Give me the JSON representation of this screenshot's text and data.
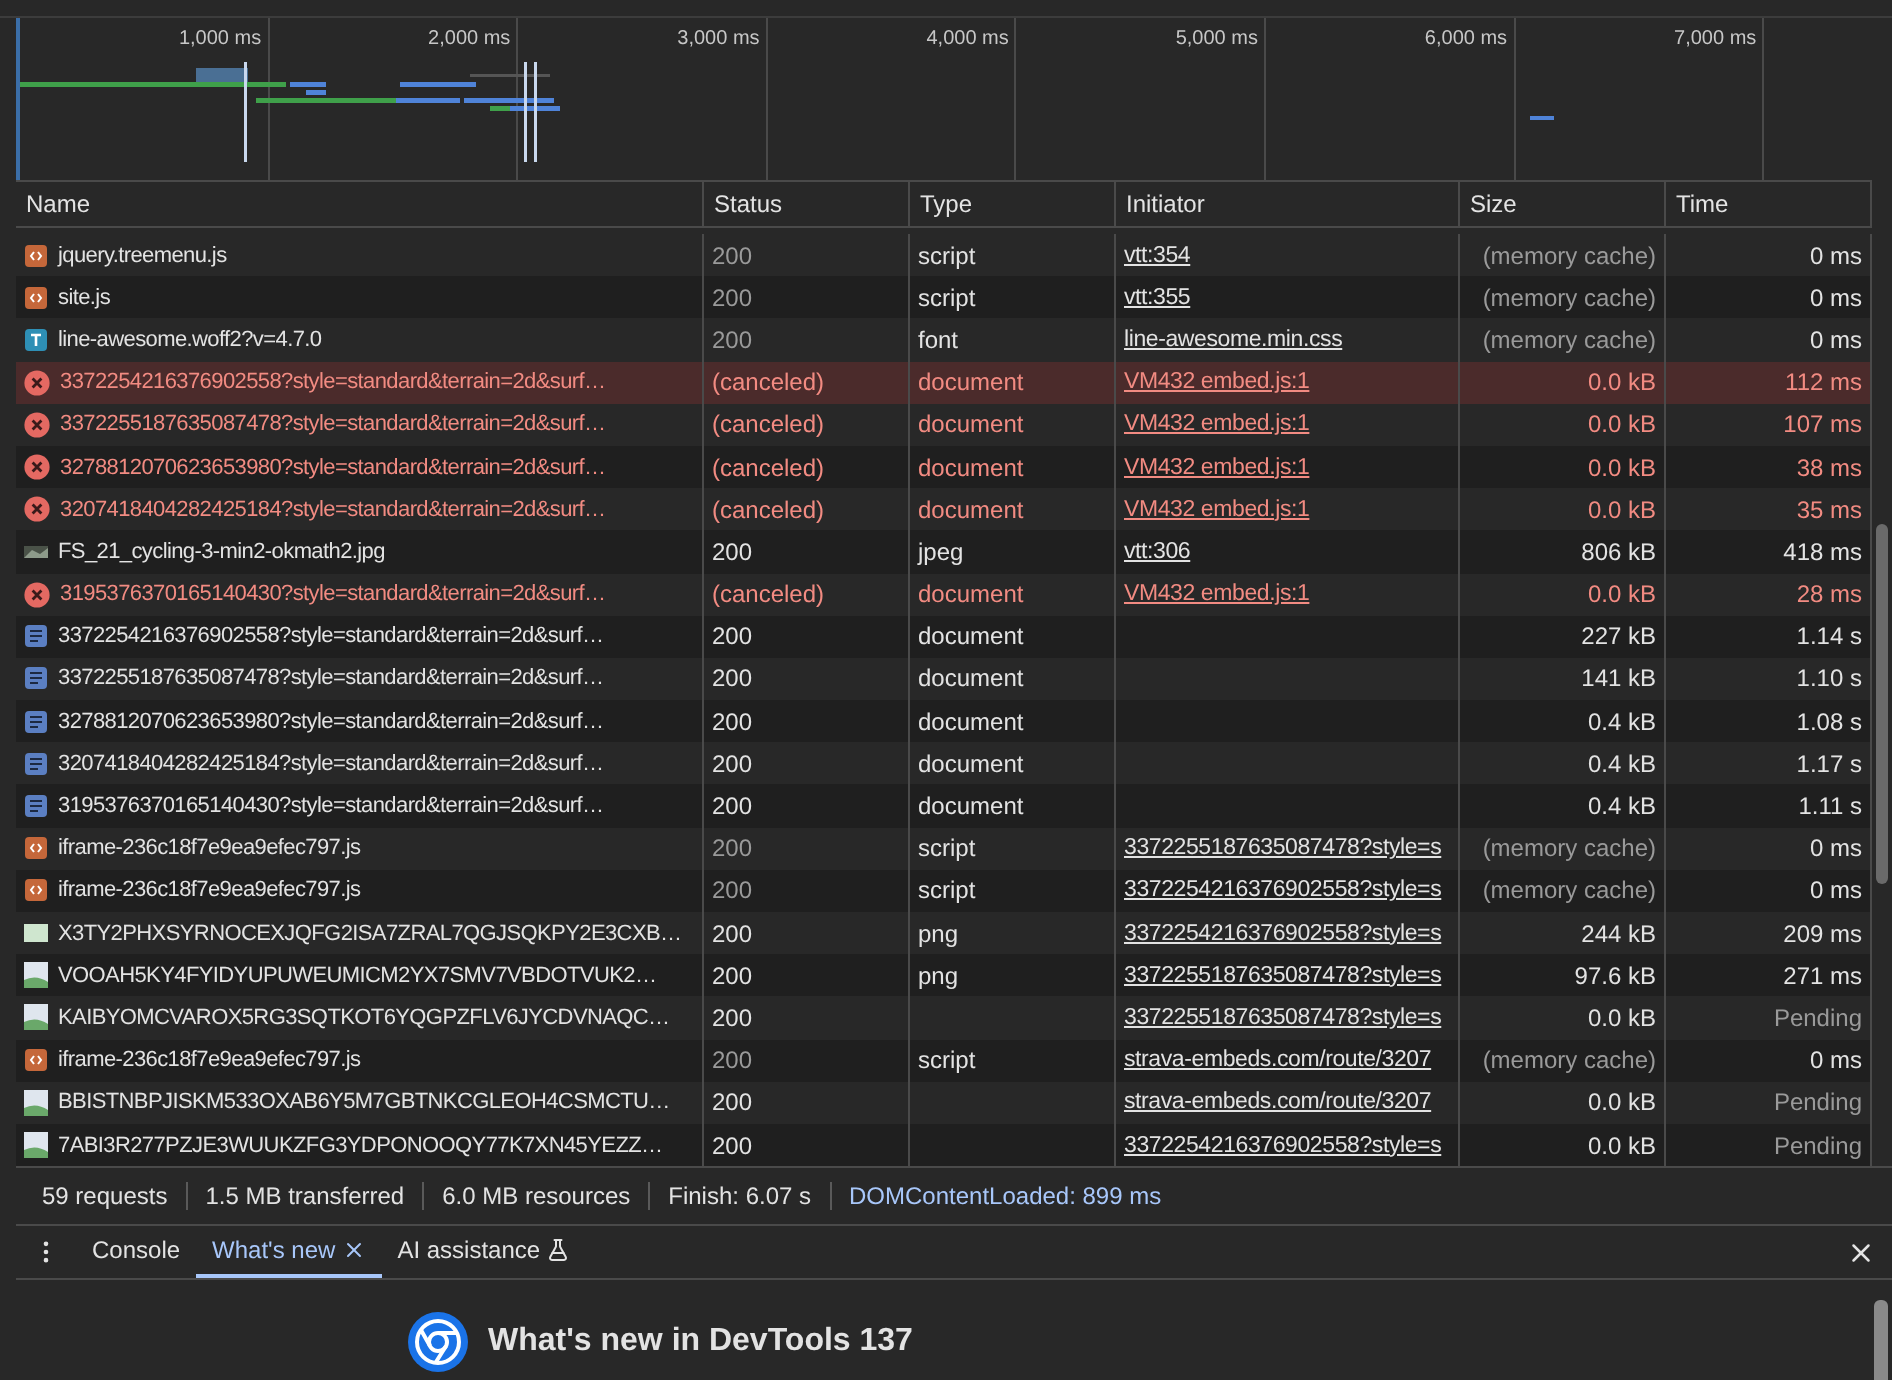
{
  "overview": {
    "ticks": [
      "1,000 ms",
      "2,000 ms",
      "3,000 ms",
      "4,000 ms",
      "5,000 ms",
      "6,000 ms",
      "7,000 ms"
    ]
  },
  "table": {
    "columns": [
      "Name",
      "Status",
      "Type",
      "Initiator",
      "Size",
      "Time"
    ],
    "rows": [
      {
        "kind": "script",
        "name": "jquery.treemenu.js",
        "status": "200",
        "type": "script",
        "initiator": "vtt:354",
        "size": "(memory cache)",
        "time": "0 ms",
        "canceled": false,
        "selected": false,
        "from_cache": true,
        "pending": false
      },
      {
        "kind": "script",
        "name": "site.js",
        "status": "200",
        "type": "script",
        "initiator": "vtt:355",
        "size": "(memory cache)",
        "time": "0 ms",
        "canceled": false,
        "selected": false,
        "from_cache": true,
        "pending": false
      },
      {
        "kind": "font",
        "name": "line-awesome.woff2?v=4.7.0",
        "status": "200",
        "type": "font",
        "initiator": "line-awesome.min.css",
        "size": "(memory cache)",
        "time": "0 ms",
        "canceled": false,
        "selected": false,
        "from_cache": true,
        "pending": false
      },
      {
        "kind": "error",
        "name": "3372254216376902558?style=standard&terrain=2d&surf…",
        "status": "(canceled)",
        "type": "document",
        "initiator": "VM432 embed.js:1",
        "size": "0.0 kB",
        "time": "112 ms",
        "canceled": true,
        "selected": true,
        "from_cache": false,
        "pending": false
      },
      {
        "kind": "error",
        "name": "3372255187635087478?style=standard&terrain=2d&surf…",
        "status": "(canceled)",
        "type": "document",
        "initiator": "VM432 embed.js:1",
        "size": "0.0 kB",
        "time": "107 ms",
        "canceled": true,
        "selected": false,
        "from_cache": false,
        "pending": false
      },
      {
        "kind": "error",
        "name": "3278812070623653980?style=standard&terrain=2d&surf…",
        "status": "(canceled)",
        "type": "document",
        "initiator": "VM432 embed.js:1",
        "size": "0.0 kB",
        "time": "38 ms",
        "canceled": true,
        "selected": false,
        "from_cache": false,
        "pending": false
      },
      {
        "kind": "error",
        "name": "3207418404282425184?style=standard&terrain=2d&surf…",
        "status": "(canceled)",
        "type": "document",
        "initiator": "VM432 embed.js:1",
        "size": "0.0 kB",
        "time": "35 ms",
        "canceled": true,
        "selected": false,
        "from_cache": false,
        "pending": false
      },
      {
        "kind": "thumbnail",
        "name": "FS_21_cycling-3-min2-okmath2.jpg",
        "status": "200",
        "type": "jpeg",
        "initiator": "vtt:306",
        "size": "806 kB",
        "time": "418 ms",
        "canceled": false,
        "selected": false,
        "from_cache": false,
        "pending": false
      },
      {
        "kind": "error",
        "name": "3195376370165140430?style=standard&terrain=2d&surf…",
        "status": "(canceled)",
        "type": "document",
        "initiator": "VM432 embed.js:1",
        "size": "0.0 kB",
        "time": "28 ms",
        "canceled": true,
        "selected": false,
        "from_cache": false,
        "pending": false
      },
      {
        "kind": "document",
        "name": "3372254216376902558?style=standard&terrain=2d&surf…",
        "status": "200",
        "type": "document",
        "initiator": "",
        "size": "227 kB",
        "time": "1.14 s",
        "canceled": false,
        "selected": false,
        "from_cache": false,
        "pending": false
      },
      {
        "kind": "document",
        "name": "3372255187635087478?style=standard&terrain=2d&surf…",
        "status": "200",
        "type": "document",
        "initiator": "",
        "size": "141 kB",
        "time": "1.10 s",
        "canceled": false,
        "selected": false,
        "from_cache": false,
        "pending": false
      },
      {
        "kind": "document",
        "name": "3278812070623653980?style=standard&terrain=2d&surf…",
        "status": "200",
        "type": "document",
        "initiator": "",
        "size": "0.4 kB",
        "time": "1.08 s",
        "canceled": false,
        "selected": false,
        "from_cache": false,
        "pending": false
      },
      {
        "kind": "document",
        "name": "3207418404282425184?style=standard&terrain=2d&surf…",
        "status": "200",
        "type": "document",
        "initiator": "",
        "size": "0.4 kB",
        "time": "1.17 s",
        "canceled": false,
        "selected": false,
        "from_cache": false,
        "pending": false
      },
      {
        "kind": "document",
        "name": "3195376370165140430?style=standard&terrain=2d&surf…",
        "status": "200",
        "type": "document",
        "initiator": "",
        "size": "0.4 kB",
        "time": "1.11 s",
        "canceled": false,
        "selected": false,
        "from_cache": false,
        "pending": false
      },
      {
        "kind": "script",
        "name": "iframe-236c18f7e9ea9efec797.js",
        "status": "200",
        "type": "script",
        "initiator": "3372255187635087478?style=s",
        "size": "(memory cache)",
        "time": "0 ms",
        "canceled": false,
        "selected": false,
        "from_cache": true,
        "pending": false
      },
      {
        "kind": "script",
        "name": "iframe-236c18f7e9ea9efec797.js",
        "status": "200",
        "type": "script",
        "initiator": "3372254216376902558?style=s",
        "size": "(memory cache)",
        "time": "0 ms",
        "canceled": false,
        "selected": false,
        "from_cache": true,
        "pending": false
      },
      {
        "kind": "flat-image",
        "name": "X3TY2PHXSYRNOCEXJQFG2ISA7ZRAL7QGJSQKPY2E3CXB…",
        "status": "200",
        "type": "png",
        "initiator": "3372254216376902558?style=s",
        "size": "244 kB",
        "time": "209 ms",
        "canceled": false,
        "selected": false,
        "from_cache": false,
        "pending": false
      },
      {
        "kind": "image",
        "name": "VOOAH5KY4FYIDYUPUWEUMICM2YX7SMV7VBDOTVUK2…",
        "status": "200",
        "type": "png",
        "initiator": "3372255187635087478?style=s",
        "size": "97.6 kB",
        "time": "271 ms",
        "canceled": false,
        "selected": false,
        "from_cache": false,
        "pending": false
      },
      {
        "kind": "image",
        "name": "KAIBYOMCVAROX5RG3SQTKOT6YQGPZFLV6JYCDVNAQC…",
        "status": "200",
        "type": "",
        "initiator": "3372255187635087478?style=s",
        "size": "0.0 kB",
        "time": "Pending",
        "canceled": false,
        "selected": false,
        "from_cache": false,
        "pending": true
      },
      {
        "kind": "script",
        "name": "iframe-236c18f7e9ea9efec797.js",
        "status": "200",
        "type": "script",
        "initiator": "strava-embeds.com/route/3207",
        "size": "(memory cache)",
        "time": "0 ms",
        "canceled": false,
        "selected": false,
        "from_cache": true,
        "pending": false
      },
      {
        "kind": "image",
        "name": "BBISTNBPJISKM533OXAB6Y5M7GBTNKCGLEOH4CSMCTU…",
        "status": "200",
        "type": "",
        "initiator": "strava-embeds.com/route/3207",
        "size": "0.0 kB",
        "time": "Pending",
        "canceled": false,
        "selected": false,
        "from_cache": false,
        "pending": true
      },
      {
        "kind": "image",
        "name": "7ABI3R277PZJE3WUUKZFG3YDPONOOQY77K7XN45YEZZ…",
        "status": "200",
        "type": "",
        "initiator": "3372254216376902558?style=s",
        "size": "0.0 kB",
        "time": "Pending",
        "canceled": false,
        "selected": false,
        "from_cache": false,
        "pending": true
      }
    ]
  },
  "status_bar": [
    {
      "text": "59 requests",
      "color": "#e3e3e3"
    },
    {
      "text": "1.5 MB transferred",
      "color": "#e3e3e3"
    },
    {
      "text": "6.0 MB resources",
      "color": "#e3e3e3"
    },
    {
      "text": "Finish: 6.07 s",
      "color": "#e3e3e3"
    },
    {
      "text": "DOMContentLoaded: 899 ms",
      "color": "#a8c7fa"
    }
  ],
  "drawer": {
    "tabs": [
      {
        "label": "Console",
        "selected": false,
        "closable": false,
        "experimental": false
      },
      {
        "label": "What's new",
        "selected": true,
        "closable": true,
        "experimental": false
      },
      {
        "label": "AI assistance",
        "selected": false,
        "closable": false,
        "experimental": true
      }
    ],
    "heading": "What's new in DevTools 137"
  }
}
